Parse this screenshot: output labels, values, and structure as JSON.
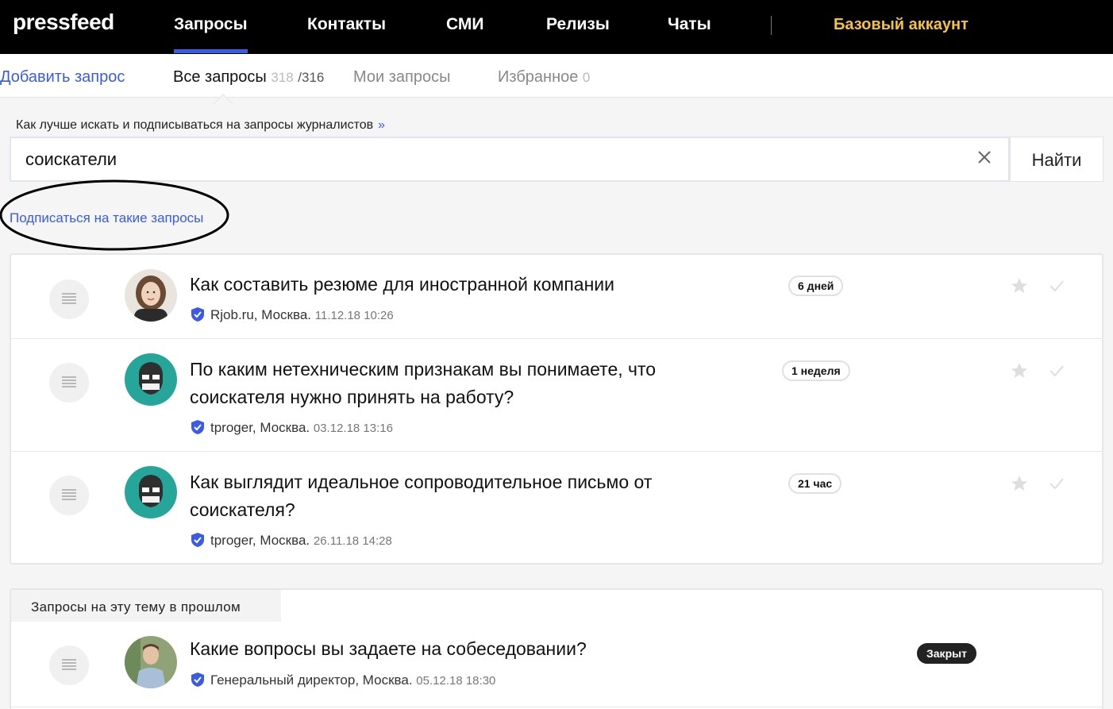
{
  "nav": {
    "logo": "pressfeed",
    "items": [
      "Запросы",
      "Контакты",
      "СМИ",
      "Релизы",
      "Чаты"
    ],
    "account": "Базовый аккаунт"
  },
  "subnav": {
    "add": "Добавить запрос",
    "all": "Все запросы",
    "all_count_total": "318",
    "all_count_sep": "/316",
    "mine": "Мои запросы",
    "fav": "Избранное",
    "fav_count": "0"
  },
  "hint": {
    "text": "Как лучше искать и подписываться на запросы журналистов",
    "arrow": "»"
  },
  "search": {
    "value": "соискатели",
    "button": "Найти"
  },
  "subscribe_link": "Подписаться на такие запросы",
  "requests": [
    {
      "title": "Как составить резюме для иностранной компании",
      "source": "Rjob.ru, Москва.",
      "date": "11.12.18 10:26",
      "badge": "6 дней",
      "avatar": "woman-avatar"
    },
    {
      "title": "По каким нетехническим признакам вы понимаете, что соискателя нужно принять на работу?",
      "source": "tproger, Москва.",
      "date": "03.12.18 13:16",
      "badge": "1 неделя",
      "avatar": "tproger-avatar"
    },
    {
      "title": "Как выглядит идеальное сопроводительное письмо от соискателя?",
      "source": "tproger, Москва.",
      "date": "26.11.18 14:28",
      "badge": "21 час",
      "avatar": "tproger-avatar"
    }
  ],
  "past": {
    "header": "Запросы на эту тему в прошлом",
    "items": [
      {
        "title": "Какие вопросы вы задаете на собеседовании?",
        "source": "Генеральный директор, Москва.",
        "date": "05.12.18 18:30",
        "badge": "Закрыт",
        "avatar": "man-avatar"
      }
    ]
  },
  "colors": {
    "accent": "#3a5be8",
    "account": "#f5c242",
    "avatar_teal": "#26a69a"
  }
}
